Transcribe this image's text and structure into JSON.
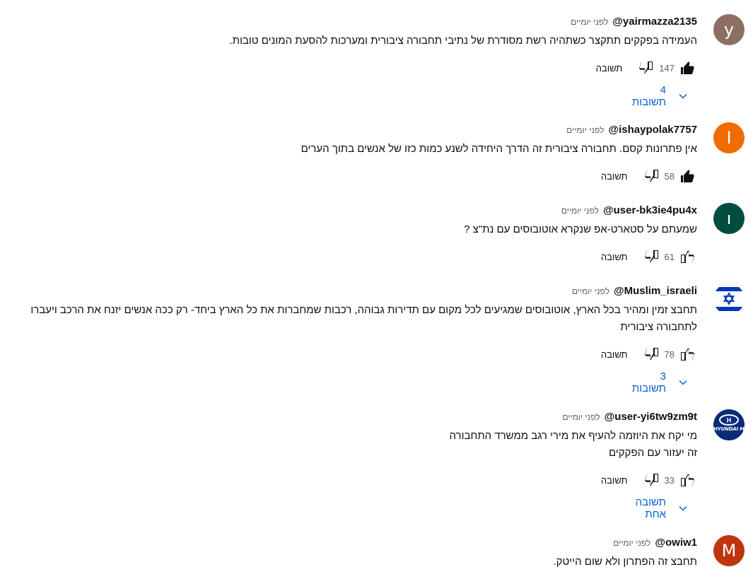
{
  "ui": {
    "reply_label": "תשובה",
    "colors": {
      "link": "#065fd4",
      "meta": "#606060"
    }
  },
  "comments": [
    {
      "author": "@yairmazza2135",
      "time": "לפני יומיים",
      "text_lines": [
        "העמידה בפקקים תתקצר כשתהיה רשת מסודרת של נתיבי תחבורה ציבורית ומערכות להסעת המונים טובות."
      ],
      "likes": "147",
      "liked": true,
      "avatar_letter": "y",
      "avatar_color": "#8d6e63",
      "replies_label": "4 תשובות"
    },
    {
      "author": "@ishaypolak7757",
      "time": "לפני יומיים",
      "text_lines": [
        "אין פתרונות קסם. תחבורה ציבורית זה הדרך היחידה לשנע כמות כזו של אנשים בתוך הערים"
      ],
      "likes": "58",
      "liked": true,
      "avatar_letter": "I",
      "avatar_color": "#ef6c00"
    },
    {
      "author": "@user-bk3ie4pu4x",
      "time": "לפני יומיים",
      "text_lines": [
        "שמעתם על סטארט-אפ שנקרא אוטובוסים עם נת\"צ ?"
      ],
      "likes": "61",
      "liked": false,
      "avatar_letter": "ו",
      "avatar_color": "#004d40"
    },
    {
      "author": "@Muslim_israeli",
      "time": "לפני יומיים",
      "text_lines": [
        "תחבצ זמין ומהיר בכל הארץ, אוטובוסים שמגיעים לכל מקום עם תדירות גבוהה, רכבות שמחברות את כל הארץ ביחד- רק ככה אנשים יזנח את הרכב ויעברו",
        "לתחבורה ציבורית"
      ],
      "likes": "78",
      "liked": false,
      "avatar_icon": "israel-flag-icon",
      "replies_label": "3 תשובות"
    },
    {
      "author": "@user-yi6tw9zm9t",
      "time": "לפני יומיים",
      "text_lines": [
        "מי יקח את היוזמה להעיף את מירי רגב ממשרד התחבורה",
        "זה יעזור עם הפקקים"
      ],
      "likes": "33",
      "liked": false,
      "avatar_icon": "hyundai-motorsport-logo",
      "avatar_text": "HYUNDAI MOTORSPORT",
      "replies_label": "תשובה אחת"
    },
    {
      "author": "@owiw1",
      "time": "לפני יומיים",
      "text_lines": [
        "תחבצ זה הפתרון ולא שום הייטק."
      ],
      "avatar_letter": "M",
      "avatar_color": "#bf360c"
    }
  ]
}
